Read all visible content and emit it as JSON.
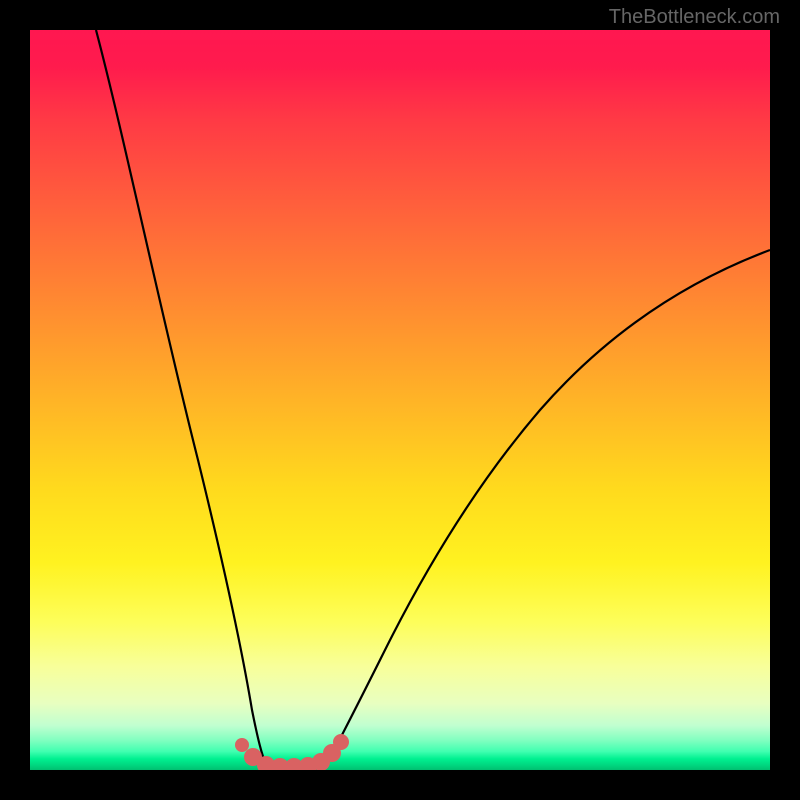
{
  "watermark": "TheBottleneck.com",
  "chart_data": {
    "type": "line",
    "title": "",
    "xlabel": "",
    "ylabel": "",
    "xlim": [
      0,
      100
    ],
    "ylim": [
      0,
      100
    ],
    "grid": false,
    "legend": false,
    "background": "gradient-red-to-green",
    "series": [
      {
        "name": "left-curve",
        "x": [
          9,
          12,
          15,
          18,
          21,
          24,
          26,
          27.5,
          29,
          30.5,
          32
        ],
        "y": [
          100,
          82,
          65,
          49,
          35,
          22,
          13,
          8,
          4,
          1.5,
          0
        ]
      },
      {
        "name": "right-curve",
        "x": [
          40,
          42,
          45,
          50,
          55,
          60,
          65,
          70,
          75,
          80,
          85,
          90,
          95,
          100
        ],
        "y": [
          0,
          2,
          6,
          14,
          22,
          30,
          37,
          43,
          49,
          54,
          58,
          62,
          65,
          68
        ]
      },
      {
        "name": "valley-floor-markers",
        "type": "scatter",
        "x": [
          28,
          30,
          32,
          34,
          36,
          38,
          40,
          42
        ],
        "y": [
          1.5,
          0.5,
          0,
          0,
          0,
          0,
          0.5,
          1.5
        ]
      }
    ],
    "colors": {
      "curve_stroke": "#000000",
      "marker_fill": "#d96262",
      "bg_top": "#ff1750",
      "bg_mid": "#ffda1d",
      "bg_bottom": "#00c070"
    }
  }
}
